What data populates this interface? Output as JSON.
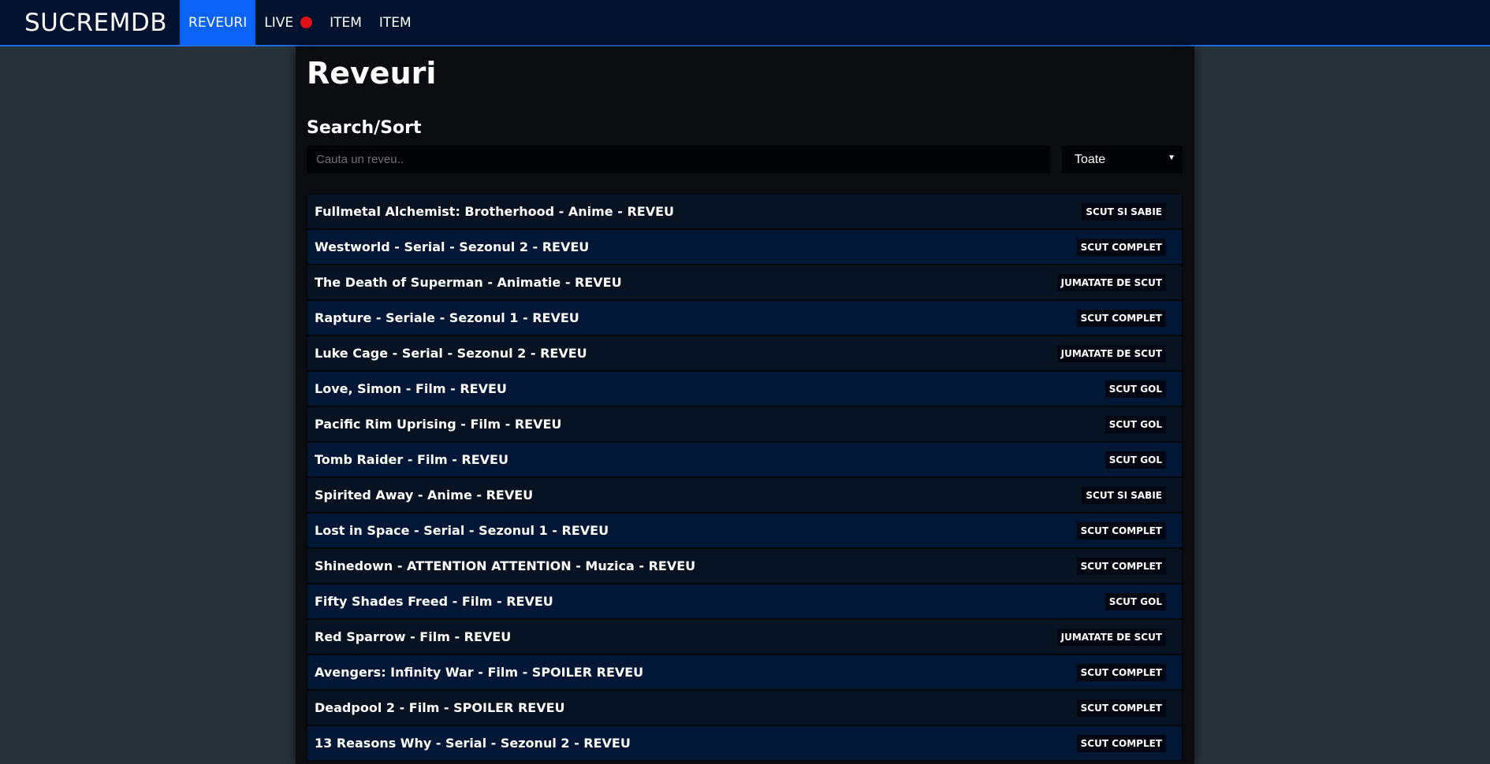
{
  "navbar": {
    "brand": "SUCREMDB",
    "items": [
      {
        "label": "REVEURI",
        "active": true
      },
      {
        "label": "LIVE",
        "live_indicator_color": "#e01218"
      },
      {
        "label": "ITEM"
      },
      {
        "label": "ITEM"
      }
    ]
  },
  "page": {
    "title": "Reveuri",
    "section_title": "Search/Sort"
  },
  "search": {
    "placeholder": "Cauta un reveu..",
    "value": ""
  },
  "filter": {
    "selected": "Toate",
    "caret_icon": "caret-down-icon"
  },
  "reviews": [
    {
      "title": "Fullmetal Alchemist: Brotherhood - Anime - REVEU",
      "rating": "SCUT SI SABIE"
    },
    {
      "title": "Westworld - Serial - Sezonul 2 - REVEU",
      "rating": "SCUT COMPLET"
    },
    {
      "title": "The Death of Superman - Animatie - REVEU",
      "rating": "JUMATATE DE SCUT"
    },
    {
      "title": "Rapture - Seriale - Sezonul 1 - REVEU",
      "rating": "SCUT COMPLET"
    },
    {
      "title": "Luke Cage - Serial - Sezonul 2 - REVEU",
      "rating": "JUMATATE DE SCUT"
    },
    {
      "title": "Love, Simon - Film - REVEU",
      "rating": "SCUT GOL"
    },
    {
      "title": "Pacific Rim Uprising - Film - REVEU",
      "rating": "SCUT GOL"
    },
    {
      "title": "Tomb Raider - Film - REVEU",
      "rating": "SCUT GOL"
    },
    {
      "title": "Spirited Away - Anime - REVEU",
      "rating": "SCUT SI SABIE"
    },
    {
      "title": "Lost in Space - Serial - Sezonul 1 - REVEU",
      "rating": "SCUT COMPLET"
    },
    {
      "title": "Shinedown - ATTENTION ATTENTION - Muzica - REVEU",
      "rating": "SCUT COMPLET"
    },
    {
      "title": "Fifty Shades Freed - Film - REVEU",
      "rating": "SCUT GOL"
    },
    {
      "title": "Red Sparrow - Film - REVEU",
      "rating": "JUMATATE DE SCUT"
    },
    {
      "title": "Avengers: Infinity War - Film - SPOILER REVEU",
      "rating": "SCUT COMPLET"
    },
    {
      "title": "Deadpool 2 - Film - SPOILER REVEU",
      "rating": "SCUT COMPLET"
    },
    {
      "title": "13 Reasons Why - Serial - Sezonul 2 - REVEU",
      "rating": "SCUT COMPLET"
    }
  ],
  "colors": {
    "navbar_bg": "#01132f",
    "active_nav_bg": "#0a63f5",
    "page_bg": "#28323a",
    "content_bg": "#0a0c10"
  }
}
